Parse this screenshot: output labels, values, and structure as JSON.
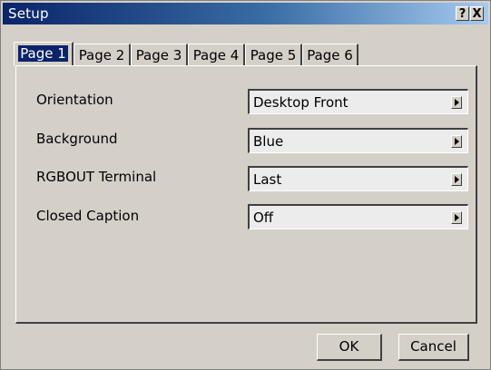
{
  "window": {
    "title": "Setup",
    "help_label": "?",
    "close_label": "X"
  },
  "tabs": [
    {
      "label": "Page 1",
      "active": true
    },
    {
      "label": "Page 2",
      "active": false
    },
    {
      "label": "Page 3",
      "active": false
    },
    {
      "label": "Page 4",
      "active": false
    },
    {
      "label": "Page 5",
      "active": false
    },
    {
      "label": "Page 6",
      "active": false
    }
  ],
  "settings": [
    {
      "label": "Orientation",
      "value": "Desktop Front"
    },
    {
      "label": "Background",
      "value": "Blue"
    },
    {
      "label": "RGBOUT Terminal",
      "value": "Last"
    },
    {
      "label": "Closed Caption",
      "value": "Off"
    }
  ],
  "buttons": {
    "ok_label": "OK",
    "cancel_label": "Cancel"
  },
  "colors": {
    "titlebar_start": "#0a246a",
    "titlebar_end": "#a6caf0",
    "selected_tab_bg": "#0a246a",
    "face": "#d4d0c8"
  }
}
